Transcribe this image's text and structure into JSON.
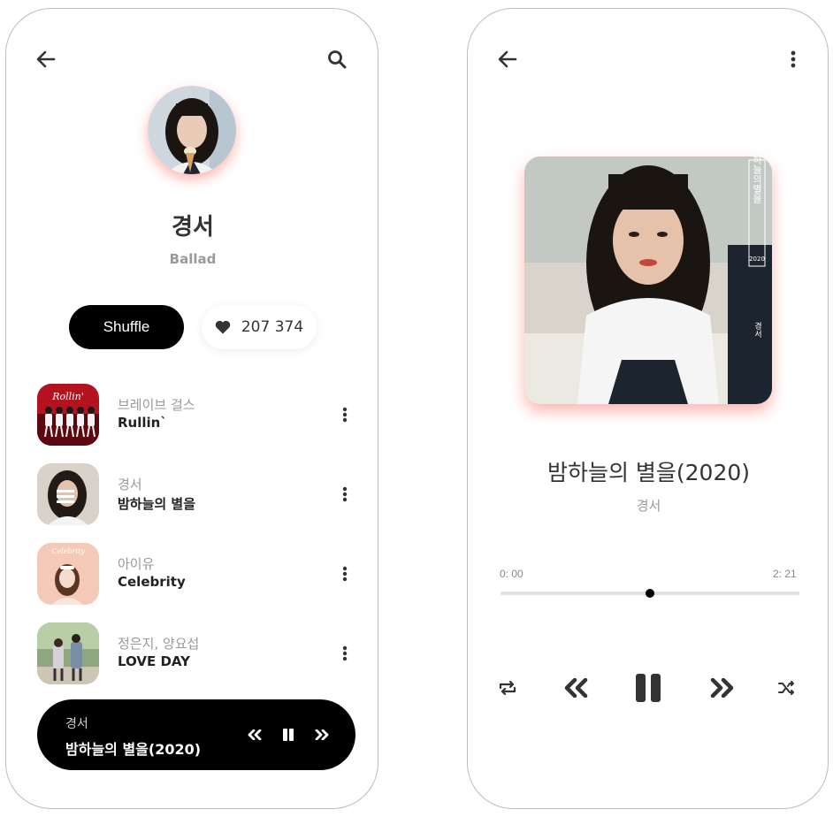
{
  "artist_screen": {
    "artist": {
      "name": "경서",
      "genre": "Ballad"
    },
    "shuffle_label": "Shuffle",
    "likes": "207 374",
    "tracks": [
      {
        "artist": "브레이브 걸스",
        "title": "Rullin`",
        "cover_text": "Rollin'"
      },
      {
        "artist": "경서",
        "title": "밤하늘의 별을"
      },
      {
        "artist": "아이유",
        "title": "Celebrity",
        "cover_text": "Celebrity"
      },
      {
        "artist": "정은지, 양요섭",
        "title": "LOVE DAY"
      }
    ],
    "now_playing": {
      "artist": "경서",
      "title": "밤하늘의 별을(2020)"
    }
  },
  "player_screen": {
    "title": "밤하늘의 별을(2020)",
    "artist": "경서",
    "time_elapsed": "0: 00",
    "time_total": "2: 21",
    "progress": 0.5,
    "cover_text": "밤하늘의별을",
    "cover_year": "2020",
    "cover_artist_text": "경서"
  },
  "colors": {
    "accent_shadow": "#ff7a6e",
    "primary": "#000000",
    "muted": "#9a9a9a"
  }
}
